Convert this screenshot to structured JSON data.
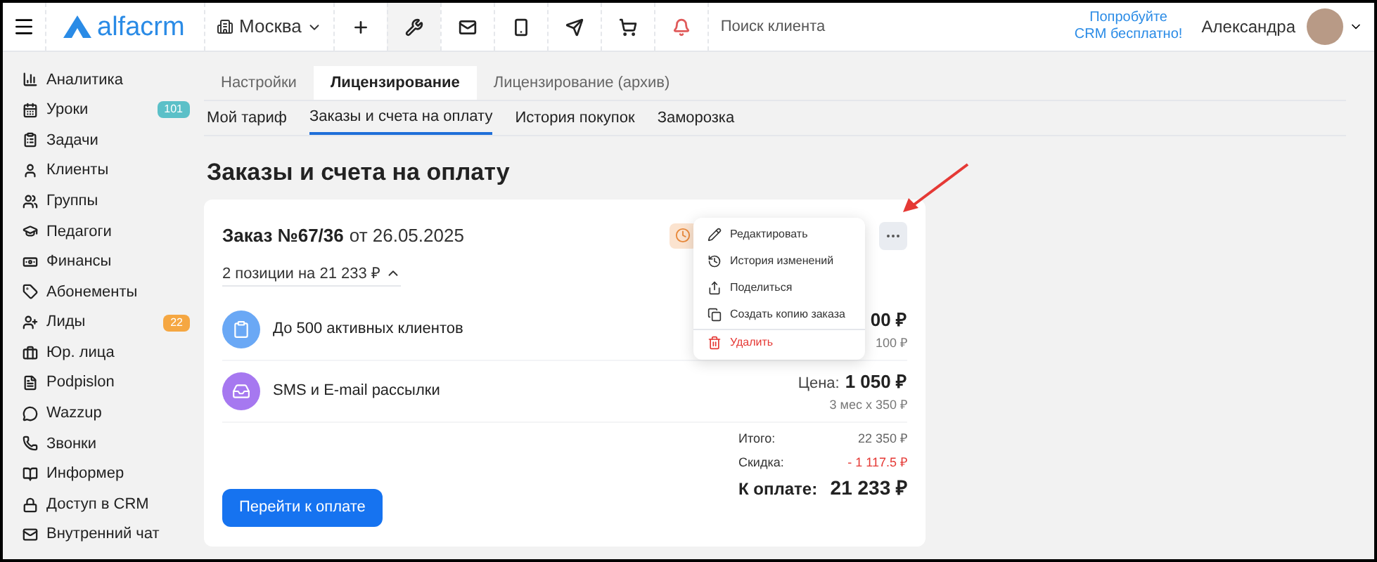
{
  "topbar": {
    "logo": "alfacrm",
    "branch": "Москва",
    "search": {
      "placeholder": "Поиск клиента"
    },
    "promo": "Попробуйте CRM бесплатно!",
    "user": "Александра"
  },
  "sidebar": {
    "items": [
      {
        "label": "Аналитика"
      },
      {
        "label": "Уроки",
        "badge": "101",
        "color": "#5bc0c8"
      },
      {
        "label": "Задачи"
      },
      {
        "label": "Клиенты"
      },
      {
        "label": "Группы"
      },
      {
        "label": "Педагоги"
      },
      {
        "label": "Финансы"
      },
      {
        "label": "Абонементы"
      },
      {
        "label": "Лиды",
        "badge": "22",
        "color": "#f5a742"
      },
      {
        "label": "Юр. лица"
      },
      {
        "label": "Podpislon"
      },
      {
        "label": "Wazzup"
      },
      {
        "label": "Звонки"
      },
      {
        "label": "Информер"
      },
      {
        "label": "Доступ в CRM"
      },
      {
        "label": "Внутренний чат"
      }
    ]
  },
  "tabs": [
    {
      "label": "Настройки",
      "selected": false
    },
    {
      "label": "Лицензирование",
      "selected": true
    },
    {
      "label": "Лицензирование (архив)",
      "selected": false
    }
  ],
  "subtabs": [
    {
      "label": "Мой тариф",
      "selected": false
    },
    {
      "label": "Заказы и счета на оплату",
      "selected": true
    },
    {
      "label": "История покупок",
      "selected": false
    },
    {
      "label": "Заморозка",
      "selected": false
    }
  ],
  "heading": "Заказы и счета на оплату",
  "order": {
    "number": "Заказ №67/36",
    "date": "от 26.05.2025",
    "summary": "2 позиции на 21 233 ₽",
    "expanded": true,
    "items": [
      {
        "name": "До 500 активных клиентов",
        "kind": "clients",
        "price": "00 ₽",
        "detail": "100 ₽"
      },
      {
        "name": "SMS и E-mail рассылки",
        "kind": "mailing",
        "price_label": "Цена:",
        "price": "1 050 ₽",
        "detail": "3 мес x 350 ₽"
      }
    ],
    "total_label": "Итого:",
    "total": "22 350 ₽",
    "discount_label": "Скидка:",
    "discount": "- 1 117.5 ₽",
    "pay_label": "К оплате:",
    "pay": "21 233 ₽",
    "pay_button": "Перейти к оплате"
  },
  "menu": {
    "items": [
      {
        "label": "Редактировать",
        "kind": "edit"
      },
      {
        "label": "История изменений",
        "kind": "history"
      },
      {
        "label": "Поделиться",
        "kind": "share"
      },
      {
        "label": "Создать копию заказа",
        "kind": "copy"
      },
      {
        "label": "Удалить",
        "kind": "delete"
      }
    ]
  }
}
